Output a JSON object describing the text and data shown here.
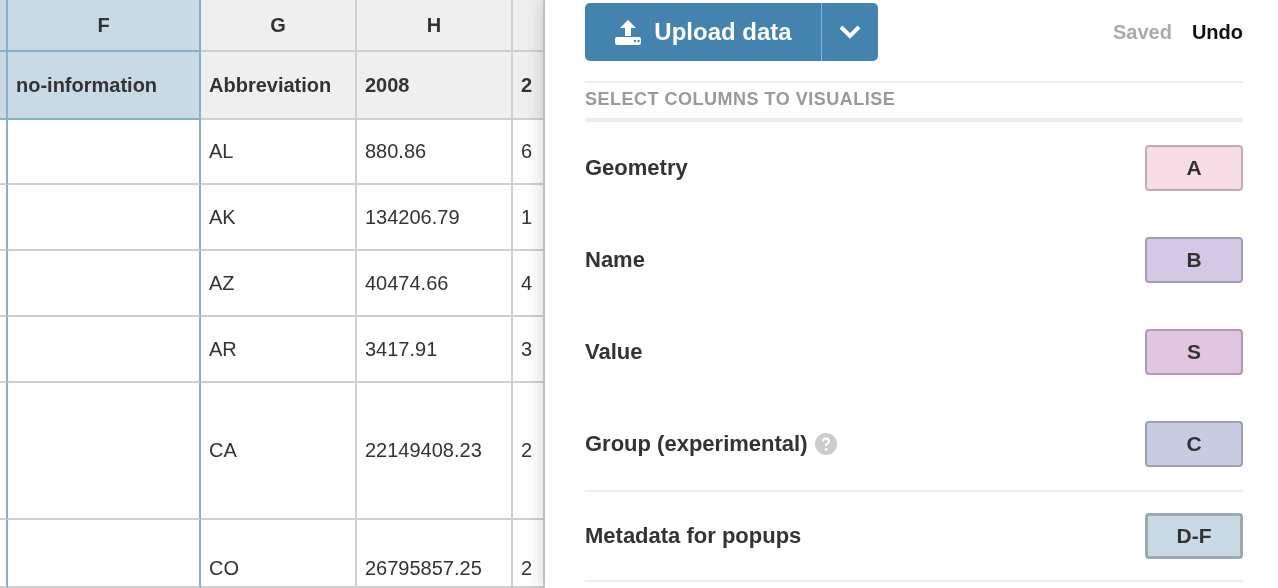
{
  "sheet": {
    "columns": [
      {
        "selected": true
      },
      {
        "letter": "F",
        "name": "no-information",
        "selected": true
      },
      {
        "letter": "G",
        "name": "Abbreviation",
        "selected": false
      },
      {
        "letter": "H",
        "name": "2008",
        "selected": false
      },
      {
        "name": "2",
        "selected": false
      }
    ],
    "rows": [
      {
        "cells": [
          null,
          null,
          "AL",
          "880.86",
          "6"
        ]
      },
      {
        "cells": [
          null,
          null,
          "AK",
          "134206.79",
          "1"
        ]
      },
      {
        "cells": [
          null,
          null,
          "AZ",
          "40474.66",
          "4"
        ]
      },
      {
        "cells": [
          null,
          null,
          "AR",
          "3417.91",
          "3"
        ]
      },
      {
        "cells": [
          null,
          null,
          "CA",
          "22149408.23",
          "2"
        ]
      },
      {
        "cells": [
          null,
          null,
          "CO",
          "26795857.25",
          "2"
        ]
      }
    ]
  },
  "panel": {
    "upload_button": "Upload data",
    "status": "Saved",
    "undo": "Undo",
    "section_title": "SELECT COLUMNS TO VISUALISE",
    "fields": [
      {
        "label": "Geometry",
        "value": "A",
        "color": "#f9dde6",
        "help": false,
        "focused": false
      },
      {
        "label": "Name",
        "value": "B",
        "color": "#d4c8e6",
        "help": false,
        "focused": false
      },
      {
        "label": "Value",
        "value": "S",
        "color": "#e2c6e0",
        "help": false,
        "focused": false
      },
      {
        "label": "Group (experimental)",
        "value": "C",
        "color": "#c7cce3",
        "help": true,
        "focused": false
      },
      {
        "label": "Metadata for popups",
        "value": "D-F",
        "color": "#c9dae4",
        "help": false,
        "focused": true
      }
    ]
  }
}
